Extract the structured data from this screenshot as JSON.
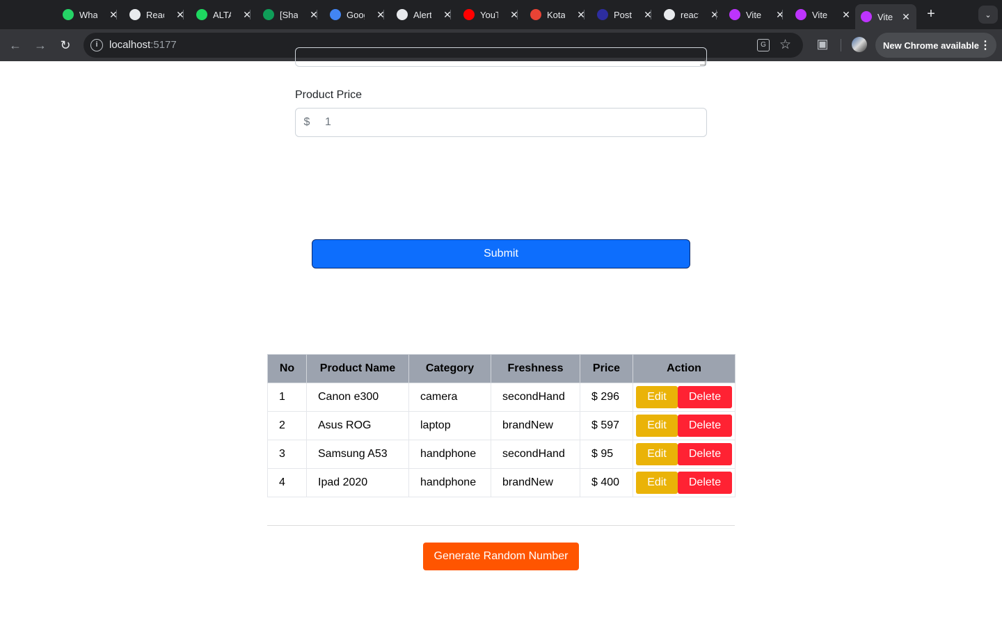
{
  "browser": {
    "tabs": [
      {
        "title": "WhatsApp",
        "favicon": "whatsapp-icon",
        "color": "#25d366"
      },
      {
        "title": "React",
        "favicon": "github-icon",
        "color": "#e8eaed"
      },
      {
        "title": "ALTA",
        "favicon": "alta-icon",
        "color": "#1ed760"
      },
      {
        "title": "[Shared]",
        "favicon": "sheets-icon",
        "color": "#0f9d58"
      },
      {
        "title": "Google",
        "favicon": "calendar-icon",
        "color": "#4285f4"
      },
      {
        "title": "Alert",
        "favicon": "openai-icon",
        "color": "#e8eaed"
      },
      {
        "title": "YouTube",
        "favicon": "youtube-icon",
        "color": "#ff0000"
      },
      {
        "title": "Kota",
        "favicon": "gmail-icon",
        "color": "#ea4335"
      },
      {
        "title": "Post",
        "favicon": "zoom-icon",
        "color": "#2d2d9f"
      },
      {
        "title": "react",
        "favicon": "github-icon",
        "color": "#e8eaed"
      },
      {
        "title": "Vite",
        "favicon": "vite-icon",
        "color": "#bd34fe"
      },
      {
        "title": "Vite",
        "favicon": "vite-icon",
        "color": "#bd34fe"
      },
      {
        "title": "Vite",
        "favicon": "vite-icon",
        "color": "#bd34fe"
      }
    ],
    "url_host": "localhost",
    "url_port": ":5177",
    "new_chrome": "New Chrome available"
  },
  "form": {
    "price_label": "Product Price",
    "currency": "$",
    "price_placeholder": "1",
    "submit_label": "Submit"
  },
  "table": {
    "headers": [
      "No",
      "Product Name",
      "Category",
      "Freshness",
      "Price",
      "Action"
    ],
    "rows": [
      {
        "no": "1",
        "name": "Canon e300",
        "category": "camera",
        "freshness": "secondHand",
        "price": "$ 296"
      },
      {
        "no": "2",
        "name": "Asus ROG",
        "category": "laptop",
        "freshness": "brandNew",
        "price": "$ 597"
      },
      {
        "no": "3",
        "name": "Samsung A53",
        "category": "handphone",
        "freshness": "secondHand",
        "price": "$ 95"
      },
      {
        "no": "4",
        "name": "Ipad 2020",
        "category": "handphone",
        "freshness": "brandNew",
        "price": "$ 400"
      }
    ],
    "edit_label": "Edit",
    "delete_label": "Delete"
  },
  "generate_label": "Generate Random Number"
}
